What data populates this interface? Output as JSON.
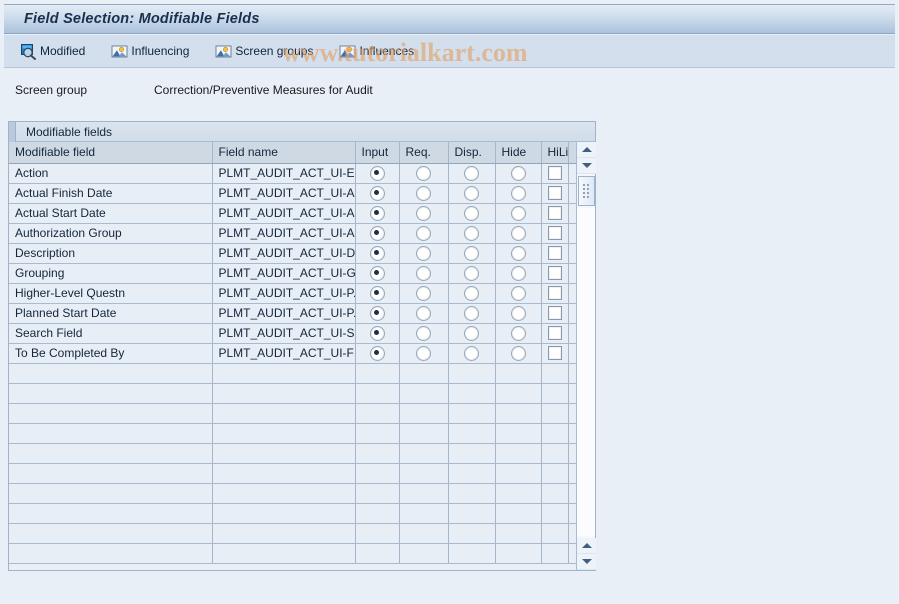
{
  "window": {
    "title": "Field Selection: Modifiable Fields"
  },
  "watermark": {
    "text": "www.tutorialkart.com",
    "color": "#e2a064"
  },
  "toolbar": {
    "buttons": [
      {
        "label": "Modified",
        "icon": "magnifier-document-icon"
      },
      {
        "label": "Influencing",
        "icon": "picture-mountain-icon"
      },
      {
        "label": "Screen groups",
        "icon": "picture-mountain-icon"
      },
      {
        "label": "Influences",
        "icon": "picture-mountain-icon"
      }
    ]
  },
  "screen_group": {
    "label": "Screen group",
    "value": "Correction/Preventive Measures for Audit"
  },
  "table": {
    "group_title": "Modifiable fields",
    "columns": [
      "Modifiable field",
      "Field name",
      "Input",
      "Req.",
      "Disp.",
      "Hide",
      "HiLi"
    ],
    "rows": [
      {
        "field": "Action",
        "field_name": "PLMT_AUDIT_ACT_UI-E...",
        "input": true,
        "req": false,
        "disp": false,
        "hide": false,
        "hili": false
      },
      {
        "field": "Actual Finish Date",
        "field_name": "PLMT_AUDIT_ACT_UI-A...",
        "input": true,
        "req": false,
        "disp": false,
        "hide": false,
        "hili": false
      },
      {
        "field": "Actual Start Date",
        "field_name": "PLMT_AUDIT_ACT_UI-A...",
        "input": true,
        "req": false,
        "disp": false,
        "hide": false,
        "hili": false
      },
      {
        "field": "Authorization Group",
        "field_name": "PLMT_AUDIT_ACT_UI-A...",
        "input": true,
        "req": false,
        "disp": false,
        "hide": false,
        "hili": false
      },
      {
        "field": "Description",
        "field_name": "PLMT_AUDIT_ACT_UI-D...",
        "input": true,
        "req": false,
        "disp": false,
        "hide": false,
        "hili": false
      },
      {
        "field": "Grouping",
        "field_name": "PLMT_AUDIT_ACT_UI-G...",
        "input": true,
        "req": false,
        "disp": false,
        "hide": false,
        "hili": false
      },
      {
        "field": "Higher-Level Questn",
        "field_name": "PLMT_AUDIT_ACT_UI-P...",
        "input": true,
        "req": false,
        "disp": false,
        "hide": false,
        "hili": false
      },
      {
        "field": "Planned Start Date",
        "field_name": "PLMT_AUDIT_ACT_UI-P...",
        "input": true,
        "req": false,
        "disp": false,
        "hide": false,
        "hili": false
      },
      {
        "field": "Search Field",
        "field_name": "PLMT_AUDIT_ACT_UI-S...",
        "input": true,
        "req": false,
        "disp": false,
        "hide": false,
        "hili": false
      },
      {
        "field": "To Be Completed By",
        "field_name": "PLMT_AUDIT_ACT_UI-FI...",
        "input": true,
        "req": false,
        "disp": false,
        "hide": false,
        "hili": false
      }
    ],
    "empty_row_count": 10
  },
  "scrollbar": {
    "up_icon": "triangle-up-icon",
    "down_icon": "triangle-down-icon",
    "thumb_icon": "grip-icon"
  }
}
